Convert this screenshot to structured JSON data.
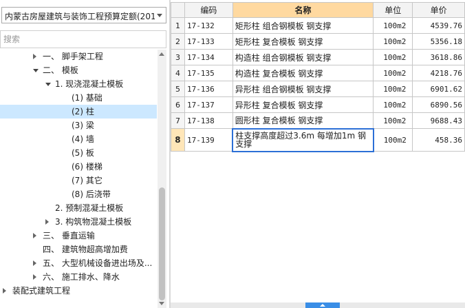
{
  "quota_selector": {
    "value": "内蒙古房屋建筑与装饰工程预算定额(201"
  },
  "search": {
    "placeholder": "搜索"
  },
  "tree": [
    {
      "label": "一、 脚手架工程",
      "expand": "collapsed",
      "level": 2
    },
    {
      "label": "二、 模板",
      "expand": "expanded",
      "level": 2
    },
    {
      "label": "1. 现浇混凝土模板",
      "expand": "expanded",
      "level": 3
    },
    {
      "label": "(1) 基础",
      "expand": "none",
      "level": 4
    },
    {
      "label": "(2) 柱",
      "expand": "none",
      "level": 4,
      "selected": true
    },
    {
      "label": "(3) 梁",
      "expand": "none",
      "level": 4
    },
    {
      "label": "(4) 墙",
      "expand": "none",
      "level": 4
    },
    {
      "label": "(5) 板",
      "expand": "none",
      "level": 4
    },
    {
      "label": "(6) 楼梯",
      "expand": "none",
      "level": 4
    },
    {
      "label": "(7) 其它",
      "expand": "none",
      "level": 4
    },
    {
      "label": "(8) 后浇带",
      "expand": "none",
      "level": 4
    },
    {
      "label": "2. 预制混凝土模板",
      "expand": "none",
      "level": 3
    },
    {
      "label": "3. 构筑物混凝土模板",
      "expand": "collapsed",
      "level": 3
    },
    {
      "label": "三、 垂直运输",
      "expand": "collapsed",
      "level": 2
    },
    {
      "label": "四、 建筑物超高增加费",
      "expand": "none",
      "level": 2
    },
    {
      "label": "五、 大型机械设备进出场及...",
      "expand": "collapsed",
      "level": 2
    },
    {
      "label": "六、 施工排水、降水",
      "expand": "collapsed",
      "level": 2
    },
    {
      "label": "装配式建筑工程",
      "expand": "collapsed",
      "level": 0
    }
  ],
  "table": {
    "headers": {
      "code": "编码",
      "name": "名称",
      "unit": "单位",
      "price": "单价"
    },
    "rows": [
      {
        "num": "1",
        "code": "17-132",
        "name": "矩形柱 组合钢模板 钢支撑",
        "unit": "100m2",
        "price": "4539.76"
      },
      {
        "num": "2",
        "code": "17-133",
        "name": "矩形柱 复合模板 钢支撑",
        "unit": "100m2",
        "price": "5356.18"
      },
      {
        "num": "3",
        "code": "17-134",
        "name": "构造柱 组合钢模板 钢支撑",
        "unit": "100m2",
        "price": "3618.86"
      },
      {
        "num": "4",
        "code": "17-135",
        "name": "构造柱 复合模板 钢支撑",
        "unit": "100m2",
        "price": "4218.76"
      },
      {
        "num": "5",
        "code": "17-136",
        "name": "异形柱 组合钢模板 钢支撑",
        "unit": "100m2",
        "price": "6901.62"
      },
      {
        "num": "6",
        "code": "17-137",
        "name": "异形柱 复合模板 钢支撑",
        "unit": "100m2",
        "price": "6890.56"
      },
      {
        "num": "7",
        "code": "17-138",
        "name": "圆形柱 复合模板 钢支撑",
        "unit": "100m2",
        "price": "9688.43"
      },
      {
        "num": "8",
        "code": "17-139",
        "name": "柱支撑高度超过3.6m 每增加1m 钢支撑",
        "unit": "100m2",
        "price": "458.36",
        "active": true
      }
    ]
  },
  "colors": {
    "selected_row": "#cce8ff",
    "header_highlight": "#ffd9a0",
    "active_border": "#2b6fd6",
    "scroll_grip": "#3a8ee6"
  }
}
